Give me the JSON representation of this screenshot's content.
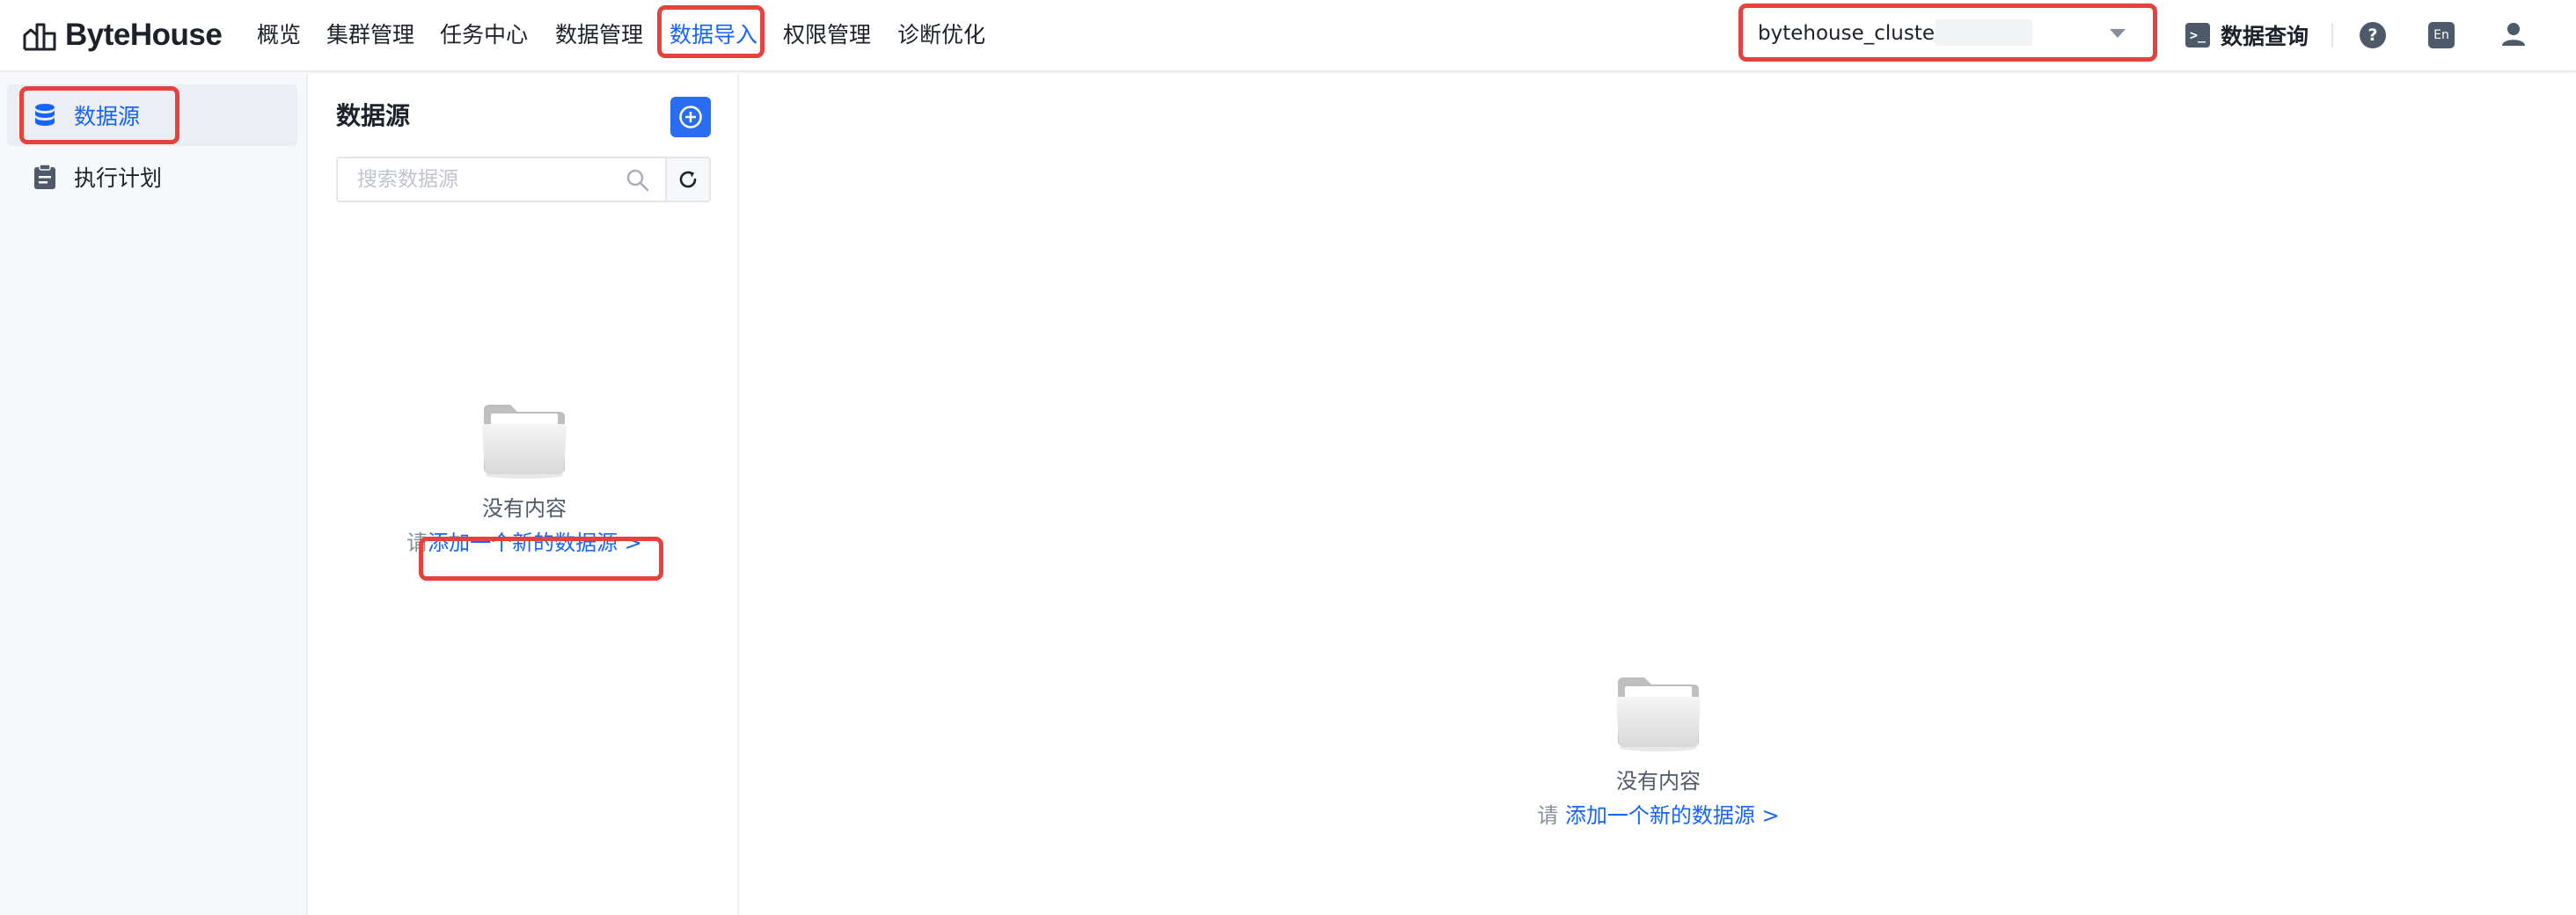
{
  "brand": {
    "name": "ByteHouse"
  },
  "nav": {
    "items": [
      "概览",
      "集群管理",
      "任务中心",
      "数据管理",
      "数据导入",
      "权限管理",
      "诊断优化"
    ],
    "active": "数据导入"
  },
  "cluster": {
    "selected": "bytehouse_cluster_"
  },
  "header": {
    "query_label": "数据查询",
    "help_glyph": "?",
    "lang_label": "En"
  },
  "sidebar": {
    "items": [
      {
        "label": "数据源",
        "icon": "database-icon",
        "active": true
      },
      {
        "label": "执行计划",
        "icon": "clipboard-icon",
        "active": false
      }
    ]
  },
  "list_panel": {
    "title": "数据源",
    "search_placeholder": "搜索数据源",
    "empty_title": "没有内容",
    "empty_prefix": "请",
    "empty_link": "添加一个新的数据源 >"
  },
  "main": {
    "empty_title": "没有内容",
    "empty_prefix": "请",
    "empty_link": "添加一个新的数据源 >"
  },
  "colors": {
    "accent": "#1664ff",
    "highlight": "#e5413d",
    "icon_dark": "#4e5969"
  }
}
